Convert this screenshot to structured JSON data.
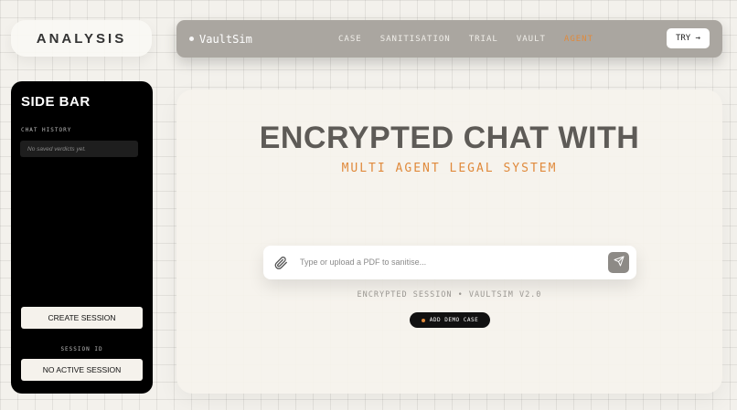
{
  "brand": {
    "title": "ANALYSIS"
  },
  "navbar": {
    "logo": "VaultSim",
    "links": [
      {
        "label": "CASE",
        "active": false
      },
      {
        "label": "SANITISATION",
        "active": false
      },
      {
        "label": "TRIAL",
        "active": false
      },
      {
        "label": "VAULT",
        "active": false
      },
      {
        "label": "AGENT",
        "active": true
      }
    ],
    "try_label": "TRY →"
  },
  "sidebar": {
    "title": "SIDE BAR",
    "history_label": "CHAT HISTORY",
    "history_empty": "No saved verdicts yet.",
    "create_label": "CREATE SESSION",
    "session_id_label": "SESSION ID",
    "session_value": "NO ACTIVE SESSION"
  },
  "main": {
    "headline": "ENCRYPTED CHAT WITH",
    "subheadline": "MULTI AGENT LEGAL SYSTEM",
    "input_placeholder": "Type or upload a PDF to sanitise...",
    "session_status": "ENCRYPTED SESSION • VAULTSIM V2.0",
    "demo_label": "ADD DEMO CASE"
  },
  "icons": {
    "attach": "paperclip-icon",
    "send": "send-icon"
  },
  "colors": {
    "accent": "#e08a3c",
    "navbar": "#aaa6a0",
    "sidebar": "#000000",
    "background": "#f3f1ec"
  }
}
